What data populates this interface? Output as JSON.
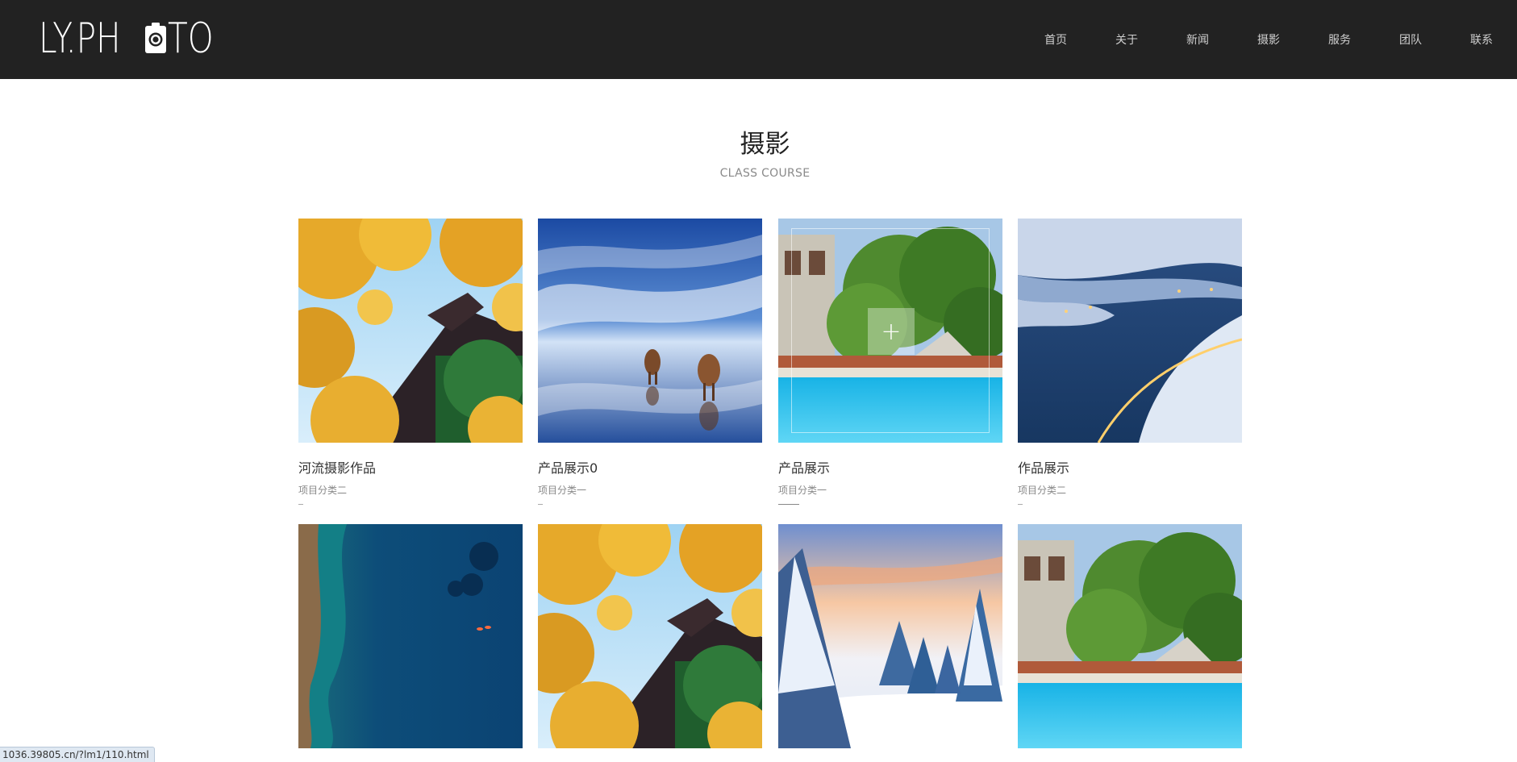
{
  "header": {
    "logo_left": "LY.PH",
    "logo_right": "TO",
    "nav": [
      "首页",
      "关于",
      "新闻",
      "摄影",
      "服务",
      "团队",
      "联系"
    ]
  },
  "section": {
    "title": "摄影",
    "subtitle": "CLASS COURSE"
  },
  "cards": [
    {
      "title": "河流摄影作品",
      "category": "项目分类二",
      "image": "ginkgo-temple"
    },
    {
      "title": "产品展示0",
      "category": "项目分类一",
      "image": "horses-sky-reflection"
    },
    {
      "title": "产品展示",
      "category": "项目分类一",
      "image": "pool-villa",
      "hovered": true
    },
    {
      "title": "作品展示",
      "category": "项目分类二",
      "image": "snowy-fjord-night"
    },
    {
      "title": "",
      "category": "",
      "image": "ocean-coast-aerial"
    },
    {
      "title": "",
      "category": "",
      "image": "ginkgo-temple"
    },
    {
      "title": "",
      "category": "",
      "image": "snow-forest-sunset"
    },
    {
      "title": "",
      "category": "",
      "image": "pool-villa"
    }
  ],
  "status_url": "1036.39805.cn/?lm1/110.html",
  "colors": {
    "header_bg": "#222222",
    "accent_text": "#333333"
  }
}
